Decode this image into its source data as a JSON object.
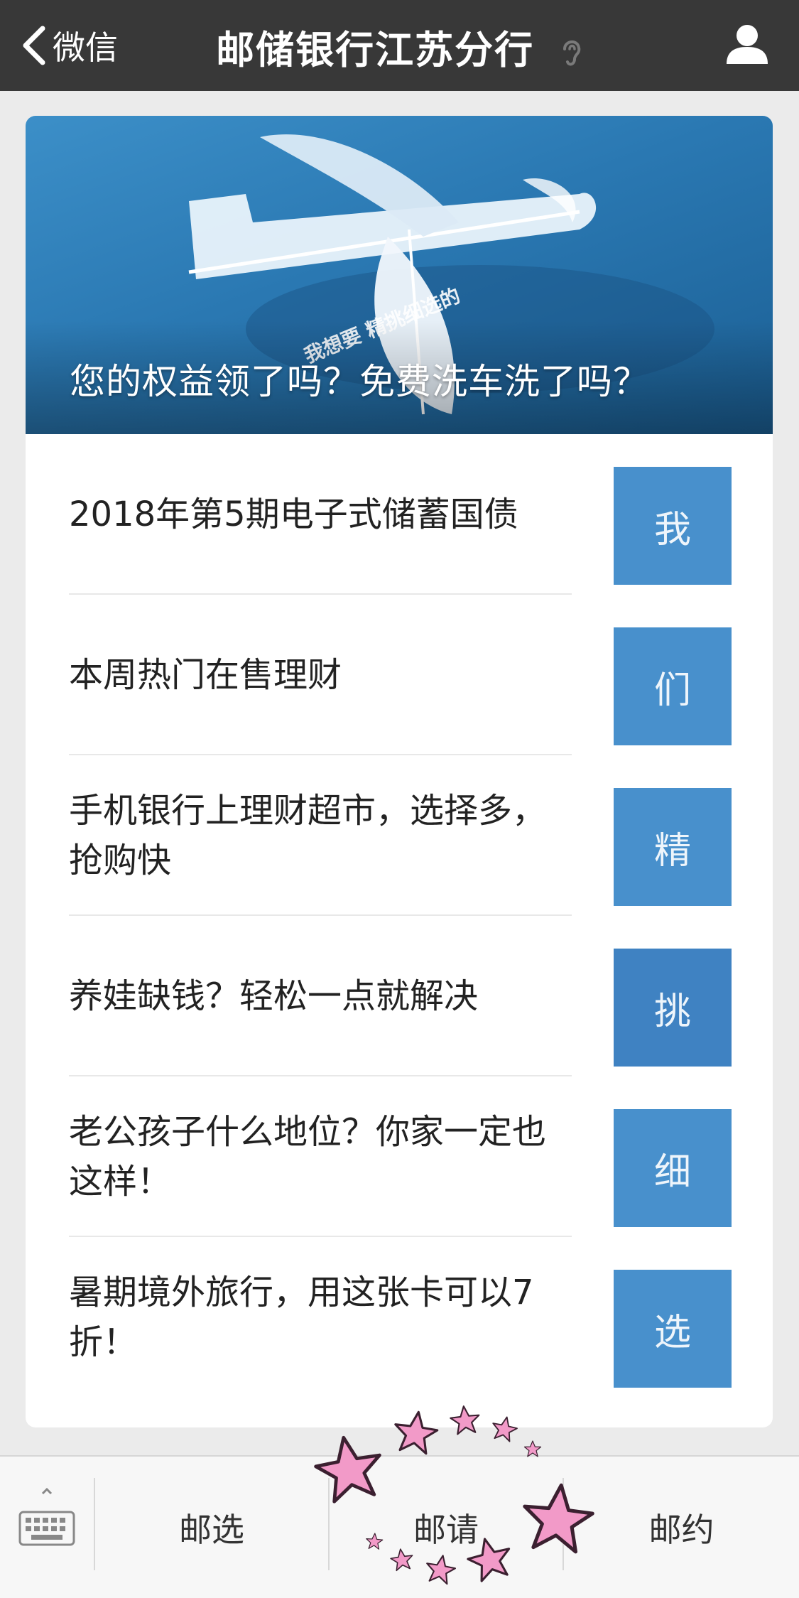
{
  "navbar": {
    "back_label": "微信",
    "title": "邮储银行江苏分行"
  },
  "hero": {
    "title": "您的权益领了吗？免费洗车洗了吗？",
    "image_text": "我想要 精挑细选的"
  },
  "articles": [
    {
      "title": "2018年第5期电子式储蓄国债",
      "thumb_char": "我"
    },
    {
      "title": "本周热门在售理财",
      "thumb_char": "们"
    },
    {
      "title": "手机银行上理财超市，选择多，抢购快",
      "thumb_char": "精"
    },
    {
      "title": "养娃缺钱？轻松一点就解决",
      "thumb_char": "挑"
    },
    {
      "title": "老公孩子什么地位？你家一定也这样！",
      "thumb_char": "细"
    },
    {
      "title": "暑期境外旅行，用这张卡可以7折！",
      "thumb_char": "选"
    }
  ],
  "bottom_menu": {
    "items": [
      "邮选",
      "邮请",
      "邮约"
    ]
  },
  "colors": {
    "navbar_bg": "#383838",
    "thumb_bg": "#4890cc",
    "page_bg": "#ebebeb",
    "star_pink": "#f29ac8"
  },
  "icons": [
    "chevron-left-icon",
    "ear-icon",
    "person-icon",
    "keyboard-icon",
    "star-sticker"
  ]
}
